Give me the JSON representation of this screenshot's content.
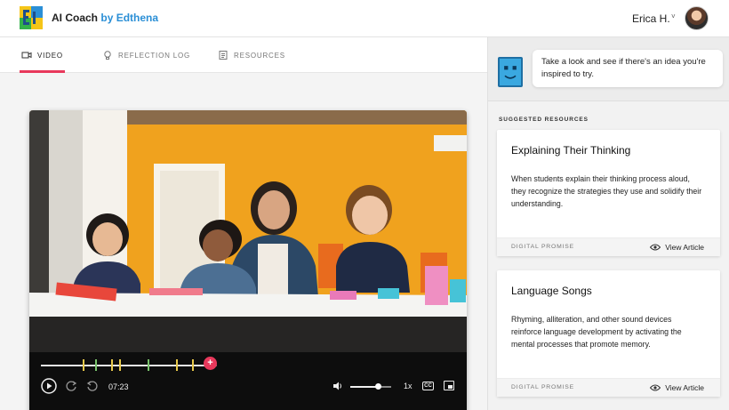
{
  "header": {
    "brand_main": "AI Coach",
    "brand_by": "by Edthena",
    "user_name": "Erica H.",
    "chevron": "˅"
  },
  "tabs": [
    {
      "label": "VIDEO",
      "icon": "video-camera-icon",
      "active": true
    },
    {
      "label": "REFLECTION LOG",
      "icon": "lightbulb-icon",
      "active": false
    },
    {
      "label": "RESOURCES",
      "icon": "document-icon",
      "active": false
    }
  ],
  "player": {
    "current_time": "07:23",
    "speed": "1x",
    "cc": "CC",
    "add_comment_symbol": "+",
    "progress_fraction": 0.95,
    "volume_fraction": 0.68,
    "marker_colors": [
      "#e8c94a",
      "#7ac46d",
      "#e8c94a",
      "#e8c94a",
      "#7ac46d",
      "#e8c94a",
      "#e8c94a"
    ]
  },
  "coach": {
    "message": "Take a look and see if there's an idea you're inspired to try."
  },
  "resources": {
    "section_title": "SUGGESTED RESOURCES",
    "cards": [
      {
        "title": "Explaining Their Thinking",
        "body": "When students explain their thinking process aloud, they recognize the strategies they use and solidify their understanding.",
        "source": "DIGITAL PROMISE",
        "link": "View Article"
      },
      {
        "title": "Language Songs",
        "body": "Rhyming, alliteration, and other sound devices reinforce language development by activating the mental processes that promote memory.",
        "source": "DIGITAL PROMISE",
        "link": "View Article"
      }
    ]
  },
  "colors": {
    "accent": "#e8385b",
    "brand_blue": "#2b8fd6",
    "wall": "#f0a21e"
  }
}
